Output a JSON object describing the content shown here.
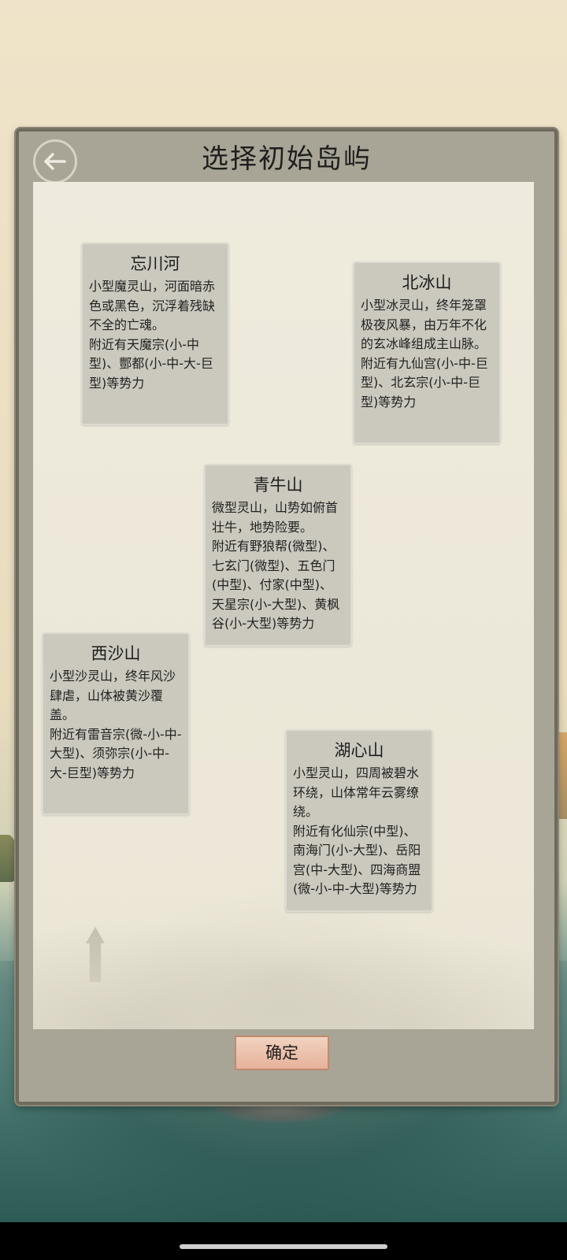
{
  "title": "选择初始岛屿",
  "confirm_label": "确定",
  "islands": [
    {
      "name": "忘川河",
      "desc": "小型魔灵山，河面暗赤色或黑色，沉浮着残缺不全的亡魂。",
      "forces": "附近有天魔宗(小-中型)、酆都(小-中-大-巨型)等势力"
    },
    {
      "name": "北冰山",
      "desc": "小型冰灵山，终年笼罩极夜风暴，由万年不化的玄冰峰组成主山脉。",
      "forces": "附近有九仙宫(小-中-巨型)、北玄宗(小-中-巨型)等势力"
    },
    {
      "name": "青牛山",
      "desc": "微型灵山，山势如俯首壮牛，地势险要。",
      "forces": "附近有野狼帮(微型)、七玄门(微型)、五色门(中型)、付家(中型)、天星宗(小-大型)、黄枫谷(小-大型)等势力"
    },
    {
      "name": "西沙山",
      "desc": "小型沙灵山，终年风沙肆虐，山体被黄沙覆盖。",
      "forces": "附近有雷音宗(微-小-中-大型)、须弥宗(小-中-大-巨型)等势力"
    },
    {
      "name": "湖心山",
      "desc": "小型灵山，四周被碧水环绕，山体常年云雾缭绕。",
      "forces": "附近有化仙宗(中型)、南海门(小-大型)、岳阳宫(中-大型)、四海商盟(微-小-中-大型)等势力"
    }
  ],
  "icons": {
    "back": "back-arrow-icon"
  },
  "colors": {
    "panel_frame": "#a8a496",
    "card_bg": "#cbc9be",
    "confirm_bg": "#e7b29b"
  }
}
